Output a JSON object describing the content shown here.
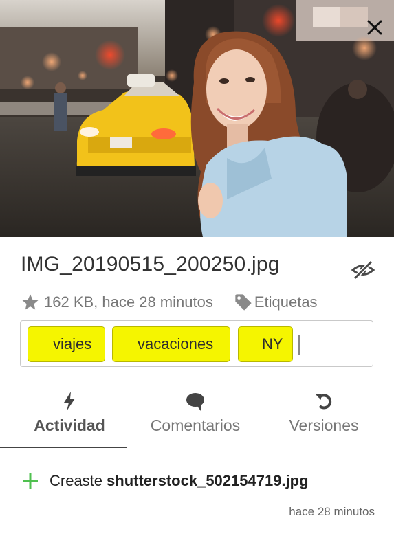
{
  "window": {
    "close_label": "close"
  },
  "file": {
    "name": "IMG_20190515_200250.jpg",
    "size": "162 KB",
    "modified": "hace 28 minutos",
    "meta_text": "162 KB, hace 28 minutos",
    "tags_label": "Etiquetas",
    "icons": {
      "favorite": "star-icon",
      "tags": "tag-icon",
      "visibility": "eye-off-icon"
    }
  },
  "tags": [
    "viajes",
    "vacaciones",
    "NY"
  ],
  "tag_highlight_color": "#f5f500",
  "tabs": [
    {
      "label": "Actividad",
      "icon": "flash-icon",
      "active": true
    },
    {
      "label": "Comentarios",
      "icon": "comment-icon",
      "active": false
    },
    {
      "label": "Versiones",
      "icon": "history-icon",
      "active": false
    }
  ],
  "activity": {
    "action": "Creaste",
    "file": "shutterstock_502154719.jpg",
    "time": "hace 28 minutos",
    "icon": "plus-icon",
    "icon_color": "#4fc04f"
  }
}
